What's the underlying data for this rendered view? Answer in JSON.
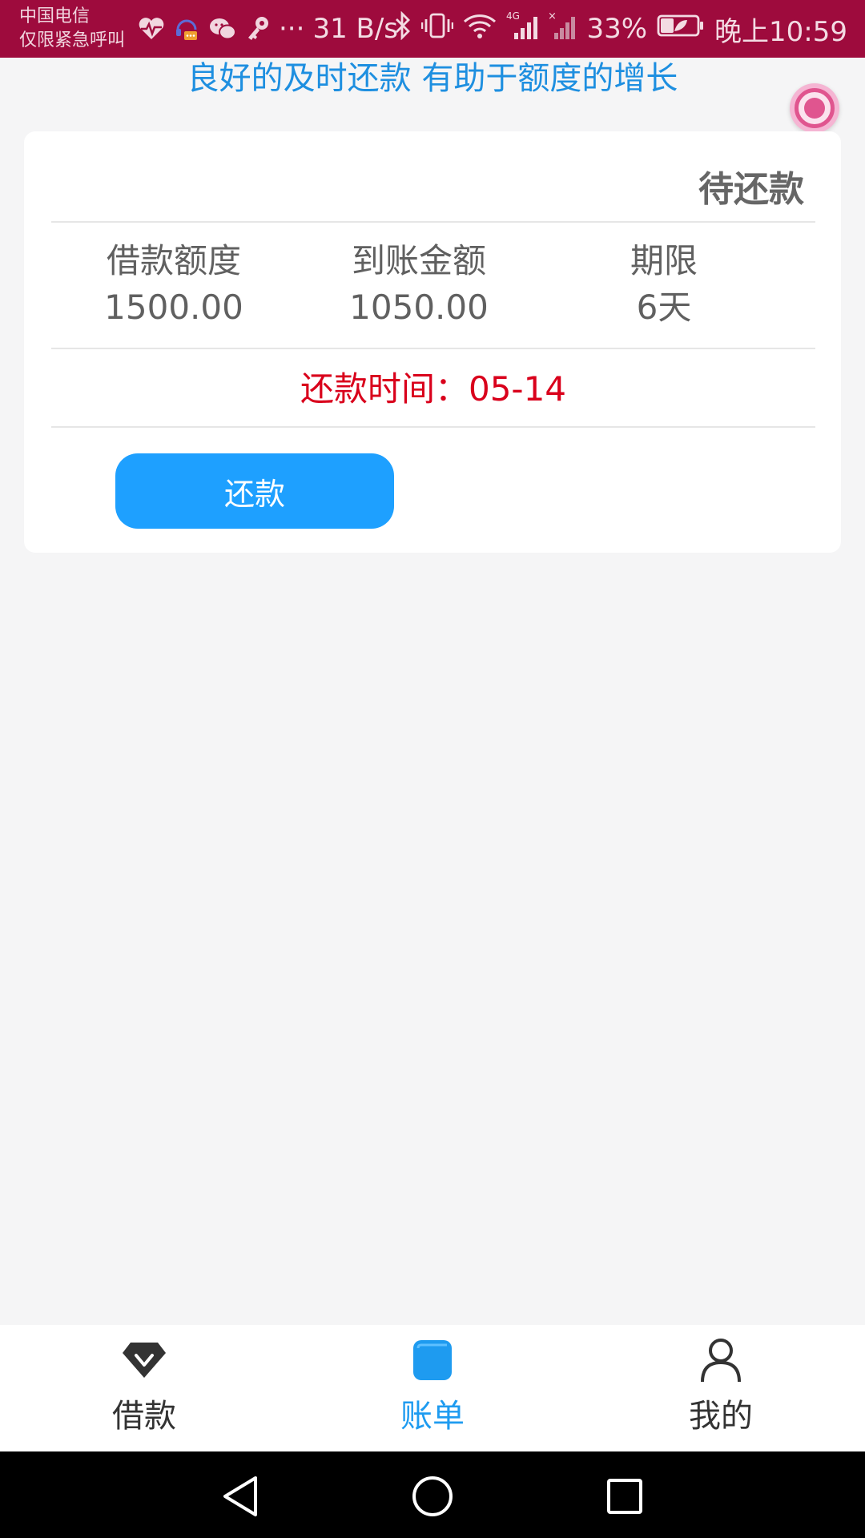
{
  "status_bar": {
    "carrier_line1": "中国电信",
    "carrier_line2": "仅限紧急呼叫",
    "more": "···",
    "net_speed": "31 B/s",
    "network_label": "4G",
    "battery_percent": "33%",
    "time": "晚上10:59",
    "background_color": "#9e0b3d",
    "icons": [
      "heart-rate-icon",
      "headset-message-icon",
      "wechat-icon",
      "key-icon",
      "bluetooth-icon",
      "vibrate-icon",
      "wifi-icon",
      "signal-4g-icon",
      "no-signal-icon",
      "battery-icon"
    ]
  },
  "banner": {
    "text": "良好的及时还款 有助于额度的增长",
    "color": "#1e8fe0"
  },
  "loan_card": {
    "status": "待还款",
    "stats": [
      {
        "label": "借款额度",
        "value": "1500.00"
      },
      {
        "label": "到账金额",
        "value": "1050.00"
      },
      {
        "label": "期限",
        "value": "6天"
      }
    ],
    "due_label": "还款时间：",
    "due_date": "05-14",
    "due_color": "#d9001b",
    "repay_button": "还款",
    "button_color": "#1ea0ff"
  },
  "tab_bar": {
    "tabs": [
      {
        "label": "借款",
        "icon": "diamond-icon",
        "active": false
      },
      {
        "label": "账单",
        "icon": "bill-icon",
        "active": true
      },
      {
        "label": "我的",
        "icon": "user-icon",
        "active": false
      }
    ],
    "active_color": "#1e9bf0"
  },
  "nav_bar": {
    "buttons": [
      "back-icon",
      "home-icon",
      "recents-icon"
    ]
  }
}
